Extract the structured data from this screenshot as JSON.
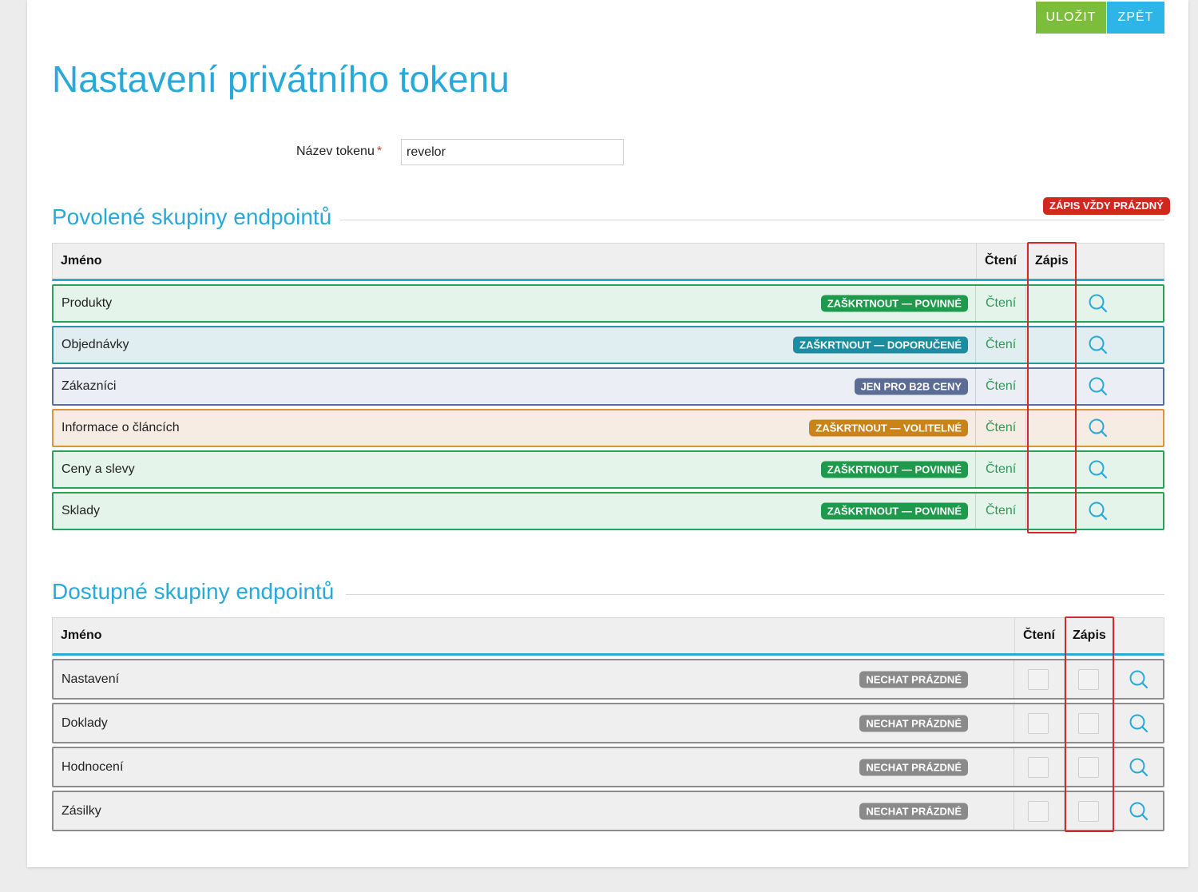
{
  "toolbar": {
    "save_label": "ULOŽIT",
    "back_label": "ZPĚT"
  },
  "page": {
    "title": "Nastavení privátního tokenu"
  },
  "token_form": {
    "label": "Název tokenu",
    "required_mark": "*",
    "value": "revelor"
  },
  "allowed": {
    "title": "Povolené skupiny endpointů",
    "note_badge": "ZÁPIS VŽDY PRÁZDNÝ",
    "columns": {
      "name": "Jméno",
      "read": "Čtení",
      "write": "Zápis"
    },
    "rows": [
      {
        "name": "Produkty",
        "tag": "ZAŠKRTNOUT — POVINNÉ",
        "read": "Čtení",
        "tone": "green"
      },
      {
        "name": "Objednávky",
        "tag": "ZAŠKRTNOUT — DOPORUČENÉ",
        "read": "Čtení",
        "tone": "teal"
      },
      {
        "name": "Zákazníci",
        "tag": "JEN PRO B2B CENY",
        "read": "Čtení",
        "tone": "slate"
      },
      {
        "name": "Informace o článcích",
        "tag": "ZAŠKRTNOUT — VOLITELNÉ",
        "read": "Čtení",
        "tone": "orange"
      },
      {
        "name": "Ceny a slevy",
        "tag": "ZAŠKRTNOUT — POVINNÉ",
        "read": "Čtení",
        "tone": "green"
      },
      {
        "name": "Sklady",
        "tag": "ZAŠKRTNOUT — POVINNÉ",
        "read": "Čtení",
        "tone": "green"
      }
    ]
  },
  "available": {
    "title": "Dostupné skupiny endpointů",
    "columns": {
      "name": "Jméno",
      "read": "Čtení",
      "write": "Zápis"
    },
    "rows": [
      {
        "name": "Nastavení",
        "tag": "NECHAT PRÁZDNÉ",
        "read_checked": false,
        "write_checked": false
      },
      {
        "name": "Doklady",
        "tag": "NECHAT PRÁZDNÉ",
        "read_checked": false,
        "write_checked": false
      },
      {
        "name": "Hodnocení",
        "tag": "NECHAT PRÁZDNÉ",
        "read_checked": false,
        "write_checked": false
      },
      {
        "name": "Zásilky",
        "tag": "NECHAT PRÁZDNÉ",
        "read_checked": false,
        "write_checked": false
      }
    ]
  },
  "colors": {
    "accent": "#29a9da",
    "save": "#7cbd3b",
    "back": "#2cb5e6",
    "highlight": "#d22a2a"
  },
  "icons": {
    "row_action": "search-icon"
  }
}
